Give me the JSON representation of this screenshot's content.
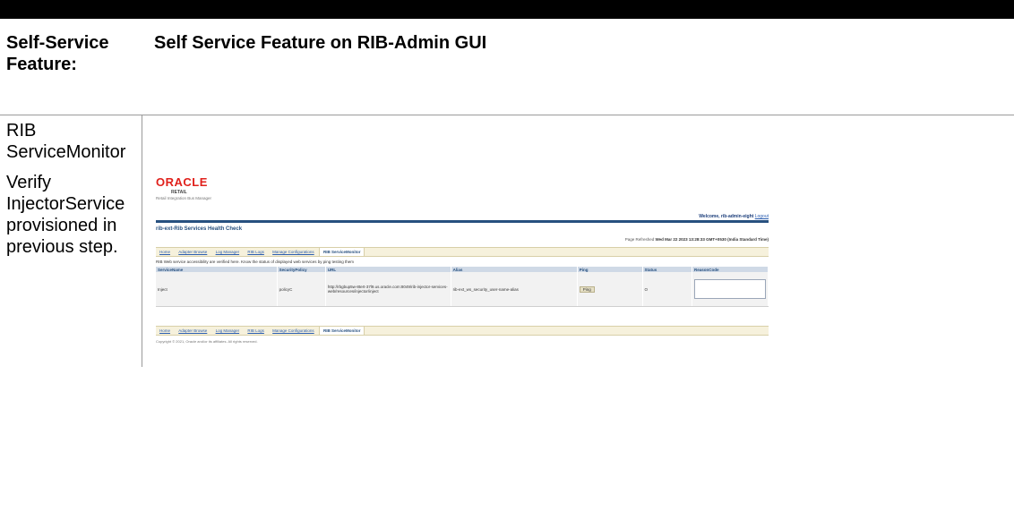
{
  "header": {
    "col1": "Self-Service Feature:",
    "col2": "Self Service Feature on RIB-Admin GUI"
  },
  "row": {
    "feature": "RIB ServiceMonitor",
    "description": "Verify InjectorService provisioned in previous step."
  },
  "screenshot": {
    "logo": "ORACLE",
    "product": "RETAIL",
    "app_name": "Retail Integration Bus Manager",
    "welcome": "Welcome, rib-admin-eight",
    "logout": "Logout",
    "page_title": "rib-ext-Rib Services Health Check",
    "refreshed_label": "Page Refreshed",
    "refreshed_value": "Wed Mar 22 2023 13:28:33 GMT+0530 (India Standard Time)",
    "tabs": [
      "Home",
      "Adapter Browse",
      "Log Manager",
      "RIB Logs",
      "Manage Configurations",
      "RIB ServiceMonitor"
    ],
    "selected_tab": "RIB ServiceMonitor",
    "description": "RIB Web service accessibility are verified here. Know the status of displayed web services by ping testing them",
    "columns": [
      "ServiceName",
      "SecurityPolicy",
      "URL",
      "Alias",
      "Ping",
      "Status",
      "ReasonCode"
    ],
    "row": {
      "service_name": "Inject",
      "security_policy": "policyC",
      "url": "http://rbgbup5w-8tert-37l9.us.oracle.com:8049/rib-injector-services-web/resources/injector/inject",
      "alias": "rib-ext_ws_security_user-name-alias",
      "ping": "Ping",
      "status": "O"
    },
    "copyright": "Copyright © 2021, Oracle and/or its affiliates. All rights reserved."
  }
}
